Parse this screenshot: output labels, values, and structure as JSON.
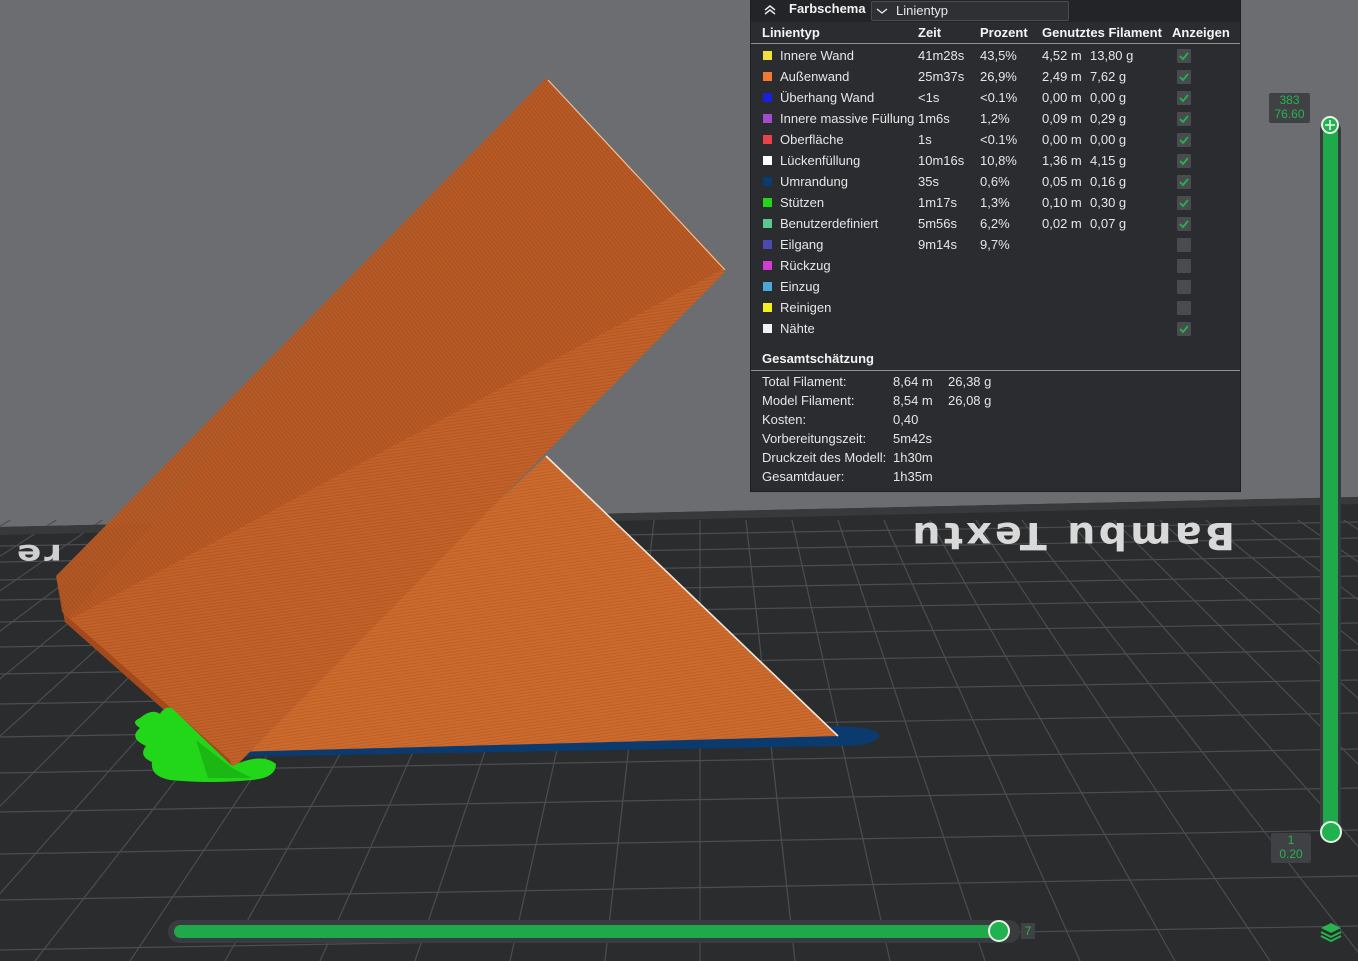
{
  "legend": {
    "header": {
      "title": "Farbschema",
      "selected_option": "Linientyp"
    },
    "columns": {
      "type": "Linientyp",
      "time": "Zeit",
      "percent": "Prozent",
      "filament": "Genutztes Filament",
      "show": "Anzeigen"
    },
    "rows": [
      {
        "name": "Innere Wand",
        "color": "#f4e03c",
        "time": "41m28s",
        "percent": "43,5%",
        "length": "4,52 m",
        "weight": "13,80 g",
        "visible": true
      },
      {
        "name": "Außenwand",
        "color": "#f07a32",
        "time": "25m37s",
        "percent": "26,9%",
        "length": "2,49 m",
        "weight": "7,62 g",
        "visible": true
      },
      {
        "name": "Überhang Wand",
        "color": "#1d1de0",
        "time": "<1s",
        "percent": "<0.1%",
        "length": "0,00 m",
        "weight": "0,00 g",
        "visible": true
      },
      {
        "name": "Innere massive Füllung",
        "color": "#a24ad0",
        "time": "1m6s",
        "percent": "1,2%",
        "length": "0,09 m",
        "weight": "0,29 g",
        "visible": true
      },
      {
        "name": "Oberfläche",
        "color": "#e8424a",
        "time": "1s",
        "percent": "<0.1%",
        "length": "0,00 m",
        "weight": "0,00 g",
        "visible": true
      },
      {
        "name": "Lückenfüllung",
        "color": "#ffffff",
        "time": "10m16s",
        "percent": "10,8%",
        "length": "1,36 m",
        "weight": "4,15 g",
        "visible": true
      },
      {
        "name": "Umrandung",
        "color": "#0a3a6e",
        "time": "35s",
        "percent": "0,6%",
        "length": "0,05 m",
        "weight": "0,16 g",
        "visible": true
      },
      {
        "name": "Stützen",
        "color": "#22d61a",
        "time": "1m17s",
        "percent": "1,3%",
        "length": "0,10 m",
        "weight": "0,30 g",
        "visible": true
      },
      {
        "name": "Benutzerdefiniert",
        "color": "#5dc792",
        "time": "5m56s",
        "percent": "6,2%",
        "length": "0,02 m",
        "weight": "0,07 g",
        "visible": true
      },
      {
        "name": "Eilgang",
        "color": "#4a4ab0",
        "time": "9m14s",
        "percent": "9,7%",
        "length": "",
        "weight": "",
        "visible": false
      },
      {
        "name": "Rückzug",
        "color": "#d43ad4",
        "time": "",
        "percent": "",
        "length": "",
        "weight": "",
        "visible": false
      },
      {
        "name": "Einzug",
        "color": "#4aa8d8",
        "time": "",
        "percent": "",
        "length": "",
        "weight": "",
        "visible": false
      },
      {
        "name": "Reinigen",
        "color": "#f5ee20",
        "time": "",
        "percent": "",
        "length": "",
        "weight": "",
        "visible": false
      },
      {
        "name": "Nähte",
        "color": "#f2f2f2",
        "time": "",
        "percent": "",
        "length": "",
        "weight": "",
        "visible": true
      }
    ],
    "summary_title": "Gesamtschätzung",
    "summary": [
      {
        "label": "Total Filament:",
        "v1": "8,64 m",
        "v2": "26,38 g"
      },
      {
        "label": "Model Filament:",
        "v1": "8,54 m",
        "v2": "26,08 g"
      },
      {
        "label": "Kosten:",
        "v1": "0,40",
        "v2": ""
      },
      {
        "label": "Vorbereitungszeit:",
        "v1": "5m42s",
        "v2": ""
      },
      {
        "label": "Druckzeit des Modell:",
        "v1": "1h30m",
        "v2": ""
      },
      {
        "label": "Gesamtdauer:",
        "v1": "1h35m",
        "v2": ""
      }
    ]
  },
  "plate": {
    "label_main": "Bambu Textu",
    "label_left": "re"
  },
  "layer_slider": {
    "top_layer": "383",
    "top_height": "76.60",
    "bottom_layer": "1",
    "bottom_height": "0.20",
    "position_fraction": 1.0
  },
  "move_slider": {
    "value": "7",
    "position_fraction": 1.0
  },
  "colors": {
    "model": "#c2622a",
    "support": "#22d61a",
    "brim": "#0a3a6e",
    "slider_accent": "#1fa94a",
    "panel_bg": "#2b2c2f"
  }
}
